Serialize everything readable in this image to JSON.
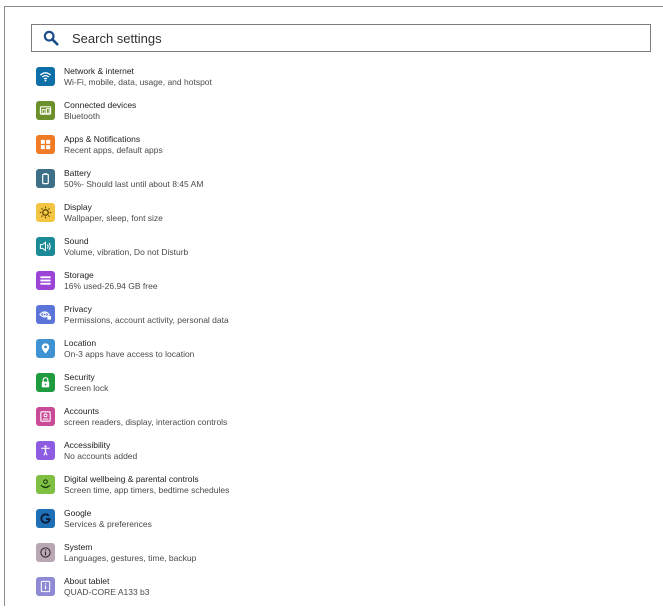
{
  "search": {
    "placeholder": "Search settings"
  },
  "colors": {
    "network": "#0e6ea8",
    "connected": "#6b8f2a",
    "apps": "#ef7b27",
    "battery": "#3d6f87",
    "display": "#f4c542",
    "sound": "#1a8a96",
    "storage": "#9b44d6",
    "privacy": "#5b74d8",
    "location": "#3f93d3",
    "security": "#1e9b3f",
    "accounts": "#c94a96",
    "accessibility": "#8d5ce0",
    "wellbeing": "#7fbf44",
    "google": "#1f6fb7",
    "system": "#b9a7b5",
    "about": "#8f8ad6"
  },
  "items": [
    {
      "title": "Network & internet",
      "subtitle": "Wi-Fi, mobile, data, usage, and hotspot",
      "icon": "wifi-icon"
    },
    {
      "title": "Connected devices",
      "subtitle": "Bluetooth",
      "icon": "connected-devices-icon"
    },
    {
      "title": "Apps & Notifications",
      "subtitle": "Recent apps, default apps",
      "icon": "apps-icon"
    },
    {
      "title": "Battery",
      "subtitle": "50%- Should last until about 8:45 AM",
      "icon": "battery-icon"
    },
    {
      "title": "Display",
      "subtitle": "Wallpaper, sleep, font size",
      "icon": "brightness-icon"
    },
    {
      "title": "Sound",
      "subtitle": "Volume, vibration, Do not Disturb",
      "icon": "speaker-icon"
    },
    {
      "title": "Storage",
      "subtitle": "16% used-26.94 GB free",
      "icon": "storage-icon"
    },
    {
      "title": "Privacy",
      "subtitle": "Permissions, account activity, personal data",
      "icon": "privacy-icon"
    },
    {
      "title": "Location",
      "subtitle": "On-3 apps have access to location",
      "icon": "location-pin-icon"
    },
    {
      "title": "Security",
      "subtitle": "Screen lock",
      "icon": "lock-icon"
    },
    {
      "title": "Accounts",
      "subtitle": "screen readers, display, interaction controls",
      "icon": "account-box-icon"
    },
    {
      "title": "Accessibility",
      "subtitle": "No accounts added",
      "icon": "accessibility-icon"
    },
    {
      "title": "Digital wellbeing & parental controls",
      "subtitle": "Screen time, app timers, bedtime schedules",
      "icon": "wellbeing-icon"
    },
    {
      "title": "Google",
      "subtitle": "Services & preferences",
      "icon": "google-icon"
    },
    {
      "title": "System",
      "subtitle": "Languages, gestures, time, backup",
      "icon": "info-circle-icon"
    },
    {
      "title": "About tablet",
      "subtitle": "QUAD-CORE A133 b3",
      "icon": "info-box-icon"
    }
  ]
}
